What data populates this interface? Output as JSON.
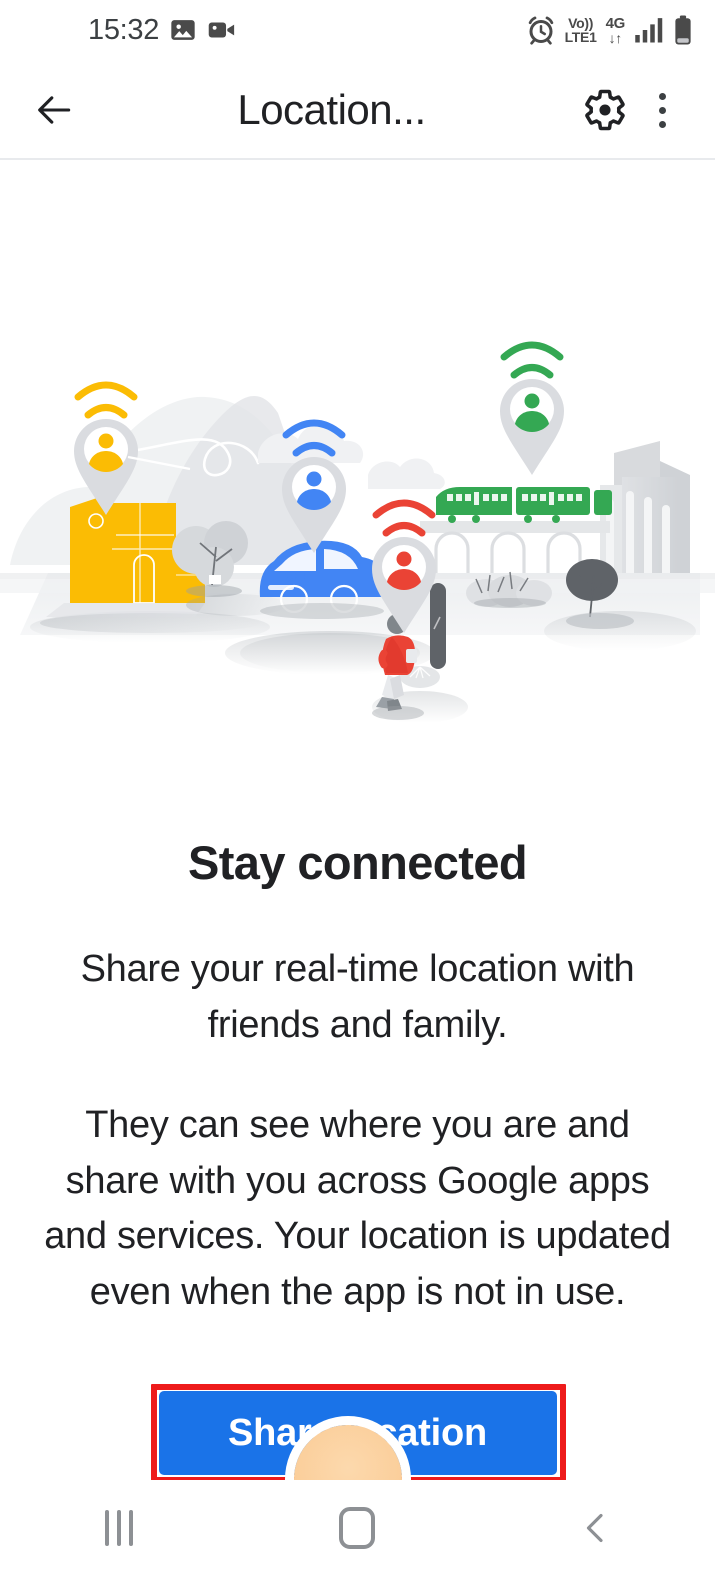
{
  "statusbar": {
    "clock": "15:32",
    "left_icons": [
      "image-icon",
      "video-camera-icon"
    ],
    "right_icons": [
      "alarm-icon",
      "volte-indicator",
      "network-4g-indicator",
      "signal-bars-icon",
      "battery-icon"
    ],
    "volte_top": "Vo))",
    "volte_bottom": "LTE1",
    "network_label": "4G",
    "network_arrows": "↓↑"
  },
  "appbar": {
    "back_icon": "arrow-left-icon",
    "title": "Location...",
    "settings_icon": "gear-icon",
    "overflow_icon": "more-vertical-icon"
  },
  "illustration": {
    "name": "stay-connected-illustration",
    "alt": "City scene with location pins, house, car, train and pedestrian",
    "pins": [
      {
        "color": "#fbbc04",
        "label": "yellow-location-pin"
      },
      {
        "color": "#4285f4",
        "label": "blue-location-pin"
      },
      {
        "color": "#ea4335",
        "label": "red-location-pin"
      },
      {
        "color": "#34a853",
        "label": "green-location-pin"
      }
    ],
    "objects": [
      "yellow-house",
      "blue-car",
      "green-train",
      "viaduct",
      "buildings",
      "trees",
      "pedestrian",
      "lamp-post",
      "mountain",
      "clouds"
    ]
  },
  "main": {
    "headline": "Stay connected",
    "paragraph_1": "Share your real-time location with friends and family.",
    "paragraph_2": "They can see where you are and share with you across Google apps and services. Your location is updated even when the app is not in use.",
    "cta_label": "Share location",
    "cta_color": "#1a73e8",
    "highlight_color": "#ee1b1b",
    "avatar": "user-avatar"
  },
  "navbar": {
    "recents_icon": "recents-icon",
    "home_icon": "home-icon",
    "back_icon": "back-chevron-icon"
  },
  "colors": {
    "accent_blue": "#1a73e8",
    "google_yellow": "#fbbc04",
    "google_red": "#ea4335",
    "google_green": "#34a853",
    "google_blue": "#4285f4",
    "text_primary": "#202124",
    "highlight_red": "#ee1b1b"
  }
}
